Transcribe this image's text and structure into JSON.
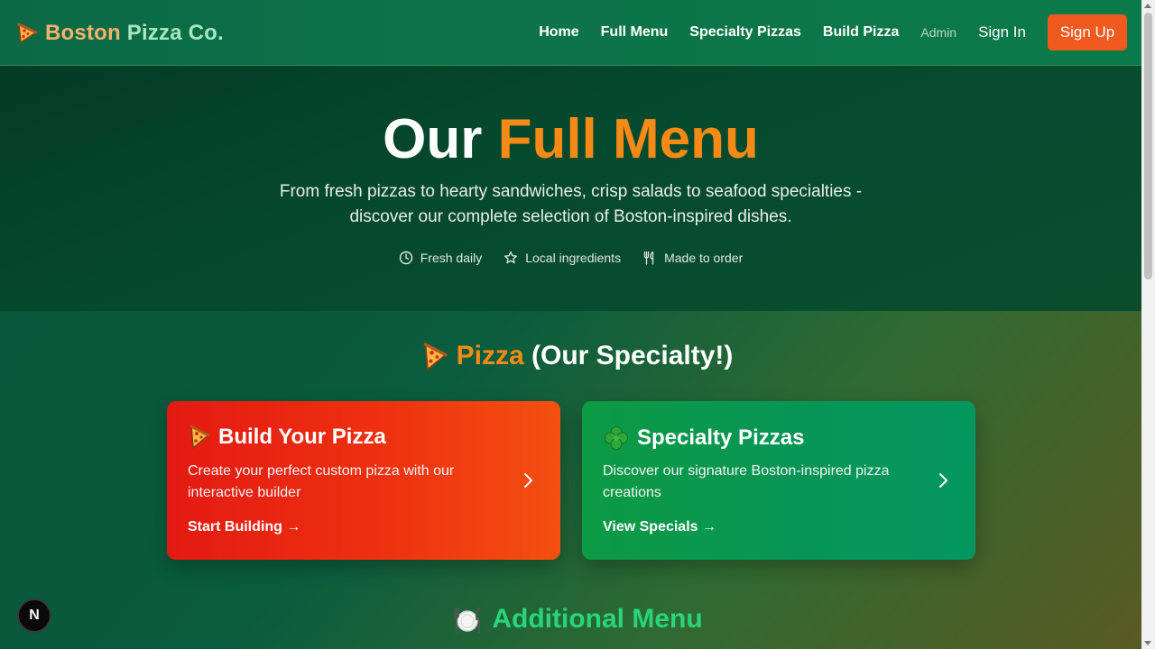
{
  "header": {
    "brand_word1": "Boston",
    "brand_word2": "Pizza Co.",
    "logo_icon": "pizza-slice-icon",
    "nav": {
      "home": "Home",
      "full_menu": "Full Menu",
      "specialty_pizzas": "Specialty Pizzas",
      "build_pizza": "Build Pizza",
      "admin": "Admin",
      "sign_in": "Sign In",
      "sign_up": "Sign Up"
    }
  },
  "hero": {
    "title_part1": "Our ",
    "title_part2": "Full Menu",
    "subtitle": "From fresh pizzas to hearty sandwiches, crisp salads to seafood specialties - discover our complete selection of Boston-inspired dishes.",
    "features": [
      {
        "icon": "clock-icon",
        "label": "Fresh daily"
      },
      {
        "icon": "star-icon",
        "label": "Local ingredients"
      },
      {
        "icon": "utensils-icon",
        "label": "Made to order"
      }
    ]
  },
  "pizza_section": {
    "title_accent": "Pizza",
    "title_rest": " (Our Specialty!)",
    "cards": [
      {
        "icon": "pizza-slice-icon",
        "title": "Build Your Pizza",
        "description": "Create your perfect custom pizza with our interactive builder",
        "link": "Start Building →"
      },
      {
        "icon": "shamrock-icon",
        "title": "Specialty Pizzas",
        "description": "Discover our signature Boston-inspired pizza creations",
        "link": "View Specials →"
      }
    ]
  },
  "additional_section": {
    "icon": "plate-utensils-icon",
    "title": "Additional Menu"
  },
  "badge": {
    "label": "N"
  },
  "colors": {
    "accent_orange": "#f58a16",
    "signup_bg": "#f15a1e",
    "header_green": "#0c7448",
    "additional_green": "#29d57a"
  }
}
